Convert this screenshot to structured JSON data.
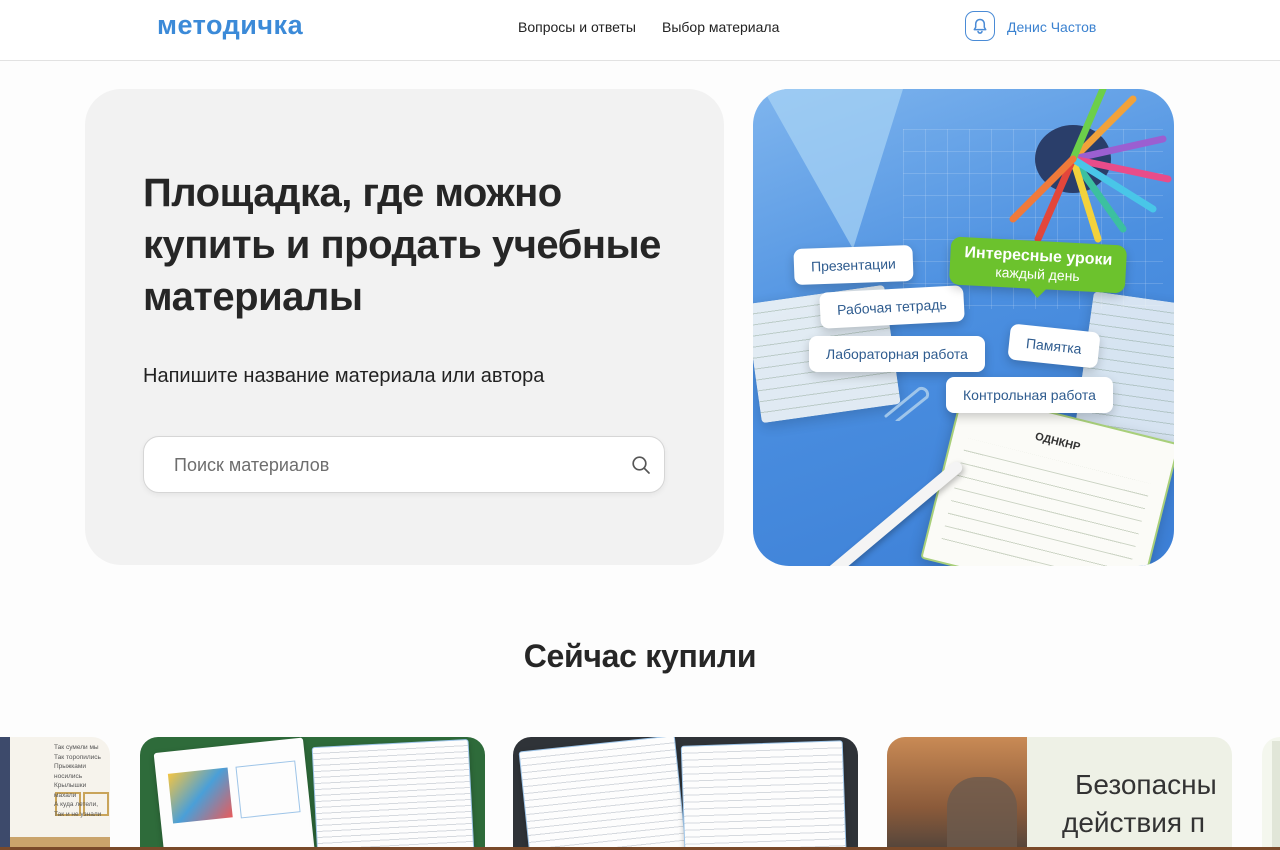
{
  "header": {
    "logo": "методичка",
    "nav": [
      {
        "label": "Вопросы и ответы"
      },
      {
        "label": "Выбор материала"
      }
    ],
    "user_name": "Денис Частов",
    "icons": {
      "notifications": "bell-icon"
    }
  },
  "hero": {
    "title": "Площадка, где можно купить и продать учебные материалы",
    "subtitle": "Напишите название материала или автора",
    "search": {
      "placeholder": "Поиск материалов",
      "value": "",
      "icon": "search-icon"
    }
  },
  "promo": {
    "tags": [
      "Презентации",
      "Рабочая тетрадь",
      "Лабораторная работа",
      "Памятка",
      "Контрольная работа"
    ],
    "highlight": {
      "line1": "Интересные уроки",
      "line2": "каждый день"
    },
    "sheet_label": "ОДНКНР"
  },
  "recent": {
    "title": "Сейчас купили",
    "cards": [
      {
        "lines": [
          "Так сумели мы",
          "Так торопились",
          "Прыжками носились",
          "Крылышки махали",
          "А куда летели,",
          "Так и не узнали"
        ]
      },
      {
        "kind": "worksheet-green"
      },
      {
        "kind": "worksheet-dark"
      },
      {
        "text_line1": "Безопасны",
        "text_line2": "действия п"
      }
    ]
  },
  "colors": {
    "accent": "#3b8ad8",
    "hero_bg": "#f2f2f2",
    "promo_blue": "#4b8fe0",
    "promo_green": "#6cc22d"
  }
}
